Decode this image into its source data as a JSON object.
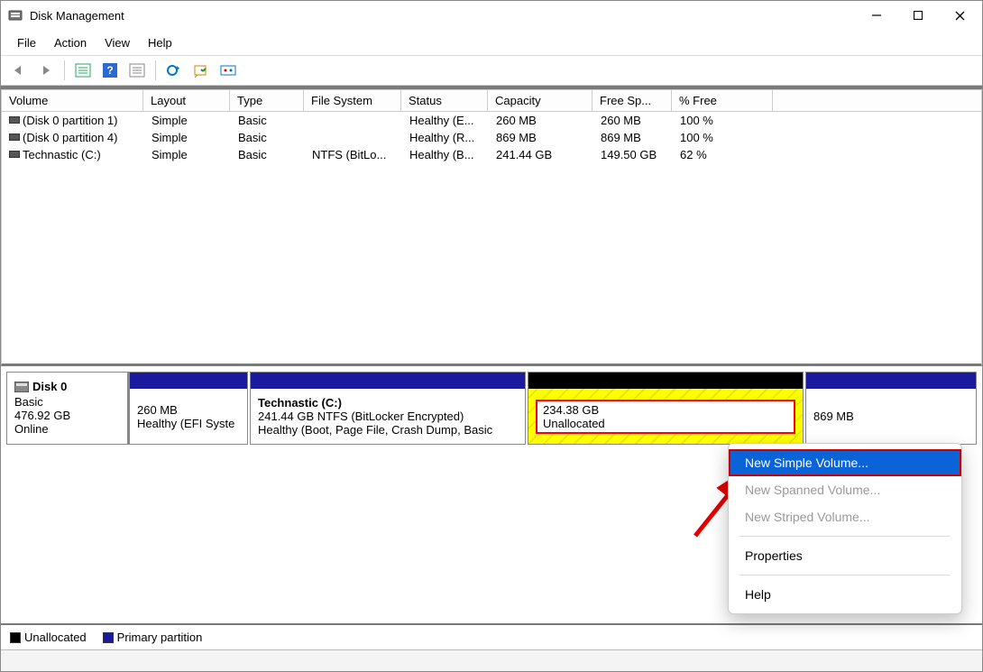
{
  "window": {
    "title": "Disk Management"
  },
  "menubar": {
    "file": "File",
    "action": "Action",
    "view": "View",
    "help": "Help"
  },
  "columns": {
    "volume": "Volume",
    "layout": "Layout",
    "type": "Type",
    "filesystem": "File System",
    "status": "Status",
    "capacity": "Capacity",
    "freespace": "Free Sp...",
    "pctfree": "% Free"
  },
  "rows": [
    {
      "volume": "(Disk 0 partition 1)",
      "layout": "Simple",
      "type": "Basic",
      "fs": "",
      "status": "Healthy (E...",
      "capacity": "260 MB",
      "free": "260 MB",
      "pct": "100 %"
    },
    {
      "volume": "(Disk 0 partition 4)",
      "layout": "Simple",
      "type": "Basic",
      "fs": "",
      "status": "Healthy (R...",
      "capacity": "869 MB",
      "free": "869 MB",
      "pct": "100 %"
    },
    {
      "volume": "Technastic (C:)",
      "layout": "Simple",
      "type": "Basic",
      "fs": "NTFS (BitLo...",
      "status": "Healthy (B...",
      "capacity": "241.44 GB",
      "free": "149.50 GB",
      "pct": "62 %"
    }
  ],
  "disk": {
    "name": "Disk 0",
    "type": "Basic",
    "size": "476.92 GB",
    "state": "Online",
    "parts": {
      "efi": {
        "size": "260 MB",
        "status": "Healthy (EFI Syste"
      },
      "c": {
        "name": "Technastic  (C:)",
        "line2": "241.44 GB NTFS (BitLocker Encrypted)",
        "line3": "Healthy (Boot, Page File, Crash Dump, Basic"
      },
      "unalloc": {
        "size": "234.38 GB",
        "label": "Unallocated"
      },
      "recovery": {
        "size": "869 MB"
      }
    }
  },
  "legend": {
    "unallocated": "Unallocated",
    "primary": "Primary partition"
  },
  "context": {
    "new_simple": "New Simple Volume...",
    "new_spanned": "New Spanned Volume...",
    "new_striped": "New Striped Volume...",
    "properties": "Properties",
    "help": "Help"
  },
  "colors": {
    "primary_header": "#1a1a9e",
    "unalloc_header": "#000000"
  }
}
